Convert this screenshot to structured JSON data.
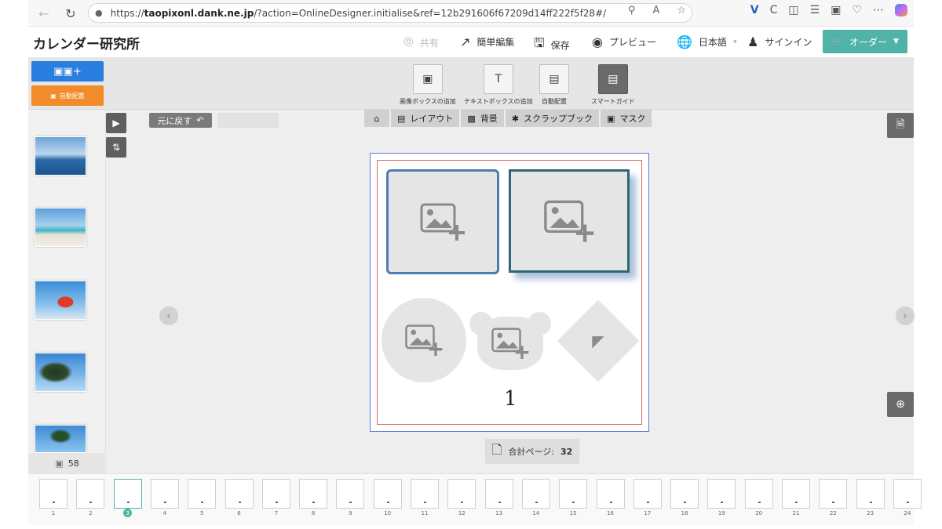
{
  "browser": {
    "url_prefix": "https://",
    "url_domain": "taopixonl.dank.ne.jp",
    "url_path": "/?action=OnlineDesigner.initialise&ref=12b291606f67209d14ff222f5f28#/"
  },
  "header": {
    "logo": "カレンダー研究所",
    "share_label": "共有",
    "easy_edit_label": "簡単編集",
    "save_label": "保存",
    "preview_label": "プレビュー",
    "language_label": "日本語",
    "signin_label": "サインイン",
    "order_label": "オーダー"
  },
  "toolbar": {
    "add_photo_label": "+",
    "auto_layout_label": "自動配置",
    "tools": [
      {
        "label": "画像ボックスの追加"
      },
      {
        "label": "テキストボックスの追加"
      },
      {
        "label": "自動配置"
      },
      {
        "label": "スマートガイド"
      }
    ]
  },
  "sidebar": {
    "photo_count": "58"
  },
  "canvas": {
    "undo_label": "元に戻す",
    "tabs": [
      {
        "label": "レイアウト"
      },
      {
        "label": "背景"
      },
      {
        "label": "スクラップブック"
      },
      {
        "label": "マスク"
      }
    ],
    "page_number": "1",
    "total_pages_label": "合計ページ:",
    "total_pages_value": "32"
  },
  "page_strip": {
    "pages": [
      "1",
      "2",
      "3",
      "4",
      "5",
      "6",
      "7",
      "8",
      "9",
      "10",
      "11",
      "12",
      "13",
      "14",
      "15",
      "16",
      "17",
      "18",
      "19",
      "20",
      "21",
      "22",
      "23",
      "24"
    ],
    "selected": "3"
  },
  "colors": {
    "order_button": "#4fb3a8",
    "add_photo_button": "#2a7de1",
    "auto_layout_button": "#f28c2a",
    "canvas_border": "#5c79d6",
    "bleed_border": "#e0665c"
  }
}
